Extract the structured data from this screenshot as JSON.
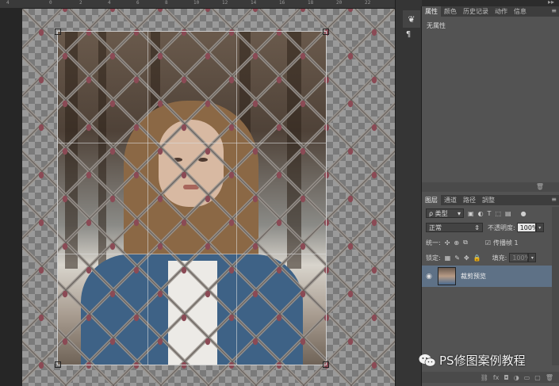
{
  "ruler": {
    "ticks": [
      "4",
      "0",
      "2",
      "4",
      "6",
      "8",
      "10",
      "12",
      "14",
      "16",
      "18",
      "20",
      "22"
    ]
  },
  "toolstrip": {
    "character_icon": "A",
    "paragraph_icon": "¶",
    "tool_icon": "❦"
  },
  "properties_panel": {
    "tabs": [
      "属性",
      "颜色",
      "历史记录",
      "动作",
      "信息"
    ],
    "content": "无属性"
  },
  "layers_panel": {
    "tabs": [
      "图层",
      "通道",
      "路径",
      "調整"
    ],
    "filter_kind": "ρ 类型",
    "blend_mode": "正常",
    "opacity_label": "不透明度:",
    "opacity_value": "100%",
    "unify_label": "统一:",
    "propagate_label": "传播帧 1",
    "lock_label": "锁定:",
    "fill_label": "填充:",
    "fill_value": "100%",
    "layer": {
      "name": "裁剪预览"
    },
    "footer_icons": [
      "link-icon",
      "fx-icon",
      "mask-icon",
      "adjustment-icon",
      "folder-icon",
      "new-layer-icon",
      "trash-icon"
    ]
  },
  "watermark": {
    "text": "PS修图案例教程"
  },
  "colors": {
    "panel_bg": "#535353",
    "selected_layer": "#5e7186",
    "canvas_bg": "#282828"
  }
}
